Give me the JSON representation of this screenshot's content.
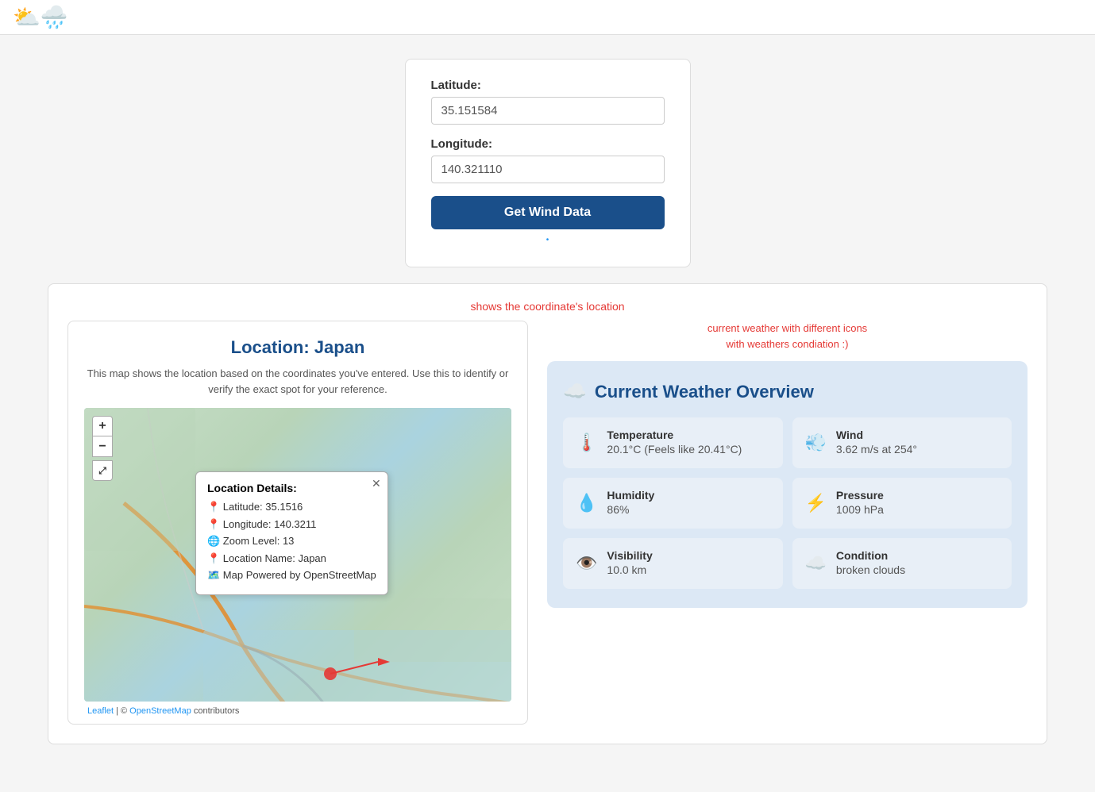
{
  "header": {
    "logo": "⛅🌧️"
  },
  "form": {
    "latitude_label": "Latitude:",
    "latitude_value": "35.151584",
    "latitude_placeholder": "35.151584",
    "longitude_label": "Longitude:",
    "longitude_value": "140.321110",
    "longitude_placeholder": "140.321110",
    "button_label": "Get Wind Data"
  },
  "map_section": {
    "hint": "shows the coordinate's location",
    "title": "Location: Japan",
    "description": "This map shows the location based on the coordinates you've entered. Use this to identify or verify the exact spot for your reference.",
    "popup": {
      "title": "Location Details:",
      "latitude": "📍 Latitude: 35.1516",
      "longitude": "📍 Longitude: 140.3211",
      "zoom": "🌐 Zoom Level: 13",
      "location_name": "📍 Location Name: Japan",
      "map_credit": "🗺️ Map Powered by OpenStreetMap"
    },
    "footer": "© OpenStreetMap contributors",
    "leaflet_label": "Leaflet"
  },
  "weather_section": {
    "hint_line1": "current weather with different icons",
    "hint_line2": "with weathers condiation :)",
    "card_title": "Current Weather Overview",
    "tiles": [
      {
        "icon": "🌡️",
        "label": "Temperature",
        "value": "20.1°C (Feels like 20.41°C)"
      },
      {
        "icon": "💨",
        "label": "Wind",
        "value": "3.62 m/s at 254°"
      },
      {
        "icon": "💧",
        "label": "Humidity",
        "value": "86%"
      },
      {
        "icon": "⚡",
        "label": "Pressure",
        "value": "1009 hPa"
      },
      {
        "icon": "👁️",
        "label": "Visibility",
        "value": "10.0 km"
      },
      {
        "icon": "☁️",
        "label": "Condition",
        "value": "broken clouds"
      }
    ]
  }
}
